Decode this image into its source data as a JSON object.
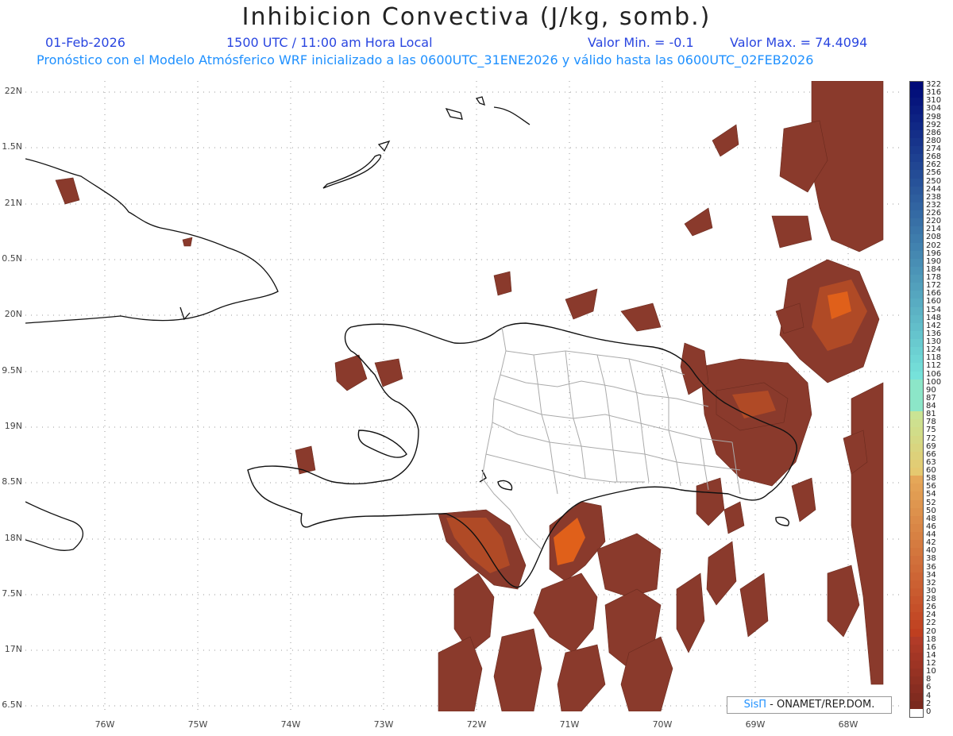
{
  "header": {
    "title": "Inhibicion Convectiva (J/kg, somb.)",
    "date": "01-Feb-2026",
    "time": "1500 UTC / 11:00 am Hora Local",
    "valmin": "Valor Min. = -0.1",
    "valmax": "Valor Max. = 74.4094",
    "subtitle": "Pronóstico con el Modelo Atmósferico WRF inicializado a las 0600UTC_31ENE2026 y válido hasta las  0600UTC_02FEB2026"
  },
  "axes": {
    "y_labels": [
      "22N",
      "1.5N",
      "21N",
      "0.5N",
      "20N",
      "9.5N",
      "19N",
      "8.5N",
      "18N",
      "7.5N",
      "17N",
      "6.5N"
    ],
    "x_labels": [
      "76W",
      "75W",
      "74W",
      "73W",
      "72W",
      "71W",
      "70W",
      "69W",
      "68W"
    ]
  },
  "colorbar": {
    "labels": [
      "322",
      "316",
      "310",
      "304",
      "298",
      "292",
      "286",
      "280",
      "274",
      "268",
      "262",
      "256",
      "250",
      "244",
      "238",
      "232",
      "226",
      "220",
      "214",
      "208",
      "202",
      "196",
      "190",
      "184",
      "178",
      "172",
      "166",
      "160",
      "154",
      "148",
      "142",
      "136",
      "130",
      "124",
      "118",
      "112",
      "106",
      "100",
      "90",
      "87",
      "84",
      "81",
      "78",
      "75",
      "72",
      "69",
      "66",
      "63",
      "60",
      "58",
      "56",
      "54",
      "52",
      "50",
      "48",
      "46",
      "44",
      "42",
      "40",
      "38",
      "36",
      "34",
      "32",
      "30",
      "28",
      "26",
      "24",
      "22",
      "20",
      "18",
      "16",
      "14",
      "12",
      "10",
      "8",
      "6",
      "4",
      "2",
      "0"
    ]
  },
  "colors": {
    "field_dark": "#8a3a2c",
    "field_mid": "#a84a2a",
    "field_hot": "#e0601a",
    "coast": "#111111",
    "provinces": "#aaaaaa"
  },
  "credit": {
    "brand": "SisΠ",
    "text": "- ONAMET/REP.DOM."
  }
}
